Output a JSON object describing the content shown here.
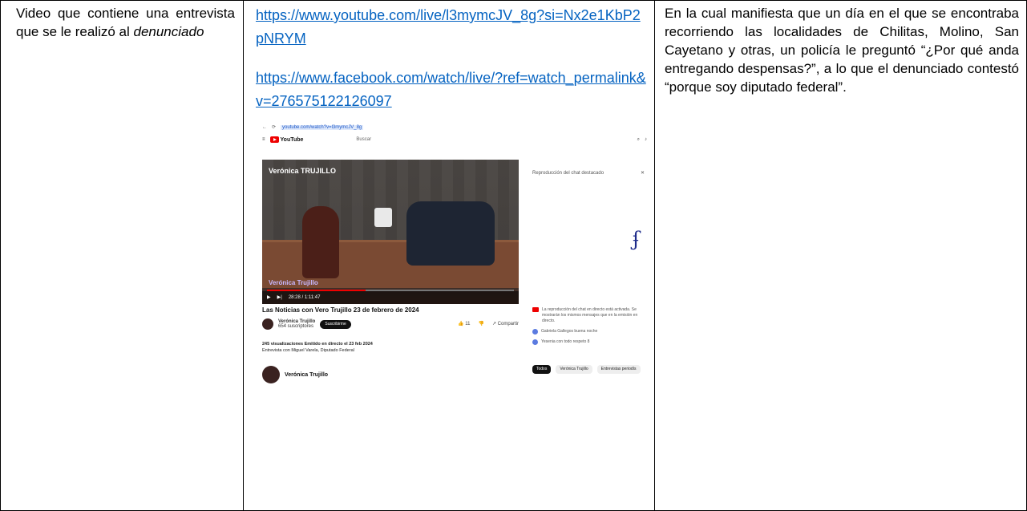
{
  "col1": {
    "text": "Video que contiene una entrevista que se le realizó al ",
    "italic": "denunciado"
  },
  "col2": {
    "link1": "https://www.youtube.com/live/l3mymcJV_8g?si=Nx2e1KbP2pNRYM",
    "link2": "https://www.facebook.com/watch/live/?ref=watch_permalink&v=276575122126097",
    "screenshot": {
      "url": "youtube.com/watch?v=l3mymcJV_8g",
      "brand": "YouTube",
      "search": "Buscar",
      "chat_header": "Reproducción del chat destacado",
      "video_overlay_title": "Verónica TRUJILLO",
      "video_overlay_name": "Verónica Trujillo",
      "time": "28:28 / 1:11:47",
      "video_title": "Las Noticias con Vero Trujillo 23 de febrero de 2024",
      "channel_name": "Verónica Trujillo",
      "subscribers": "654 suscriptores",
      "subscribe_label": "Suscribirme",
      "likes": "11",
      "share_label": "Compartir",
      "views_line": "245 visualizaciones  Emitido en directo el 23 feb 2024",
      "description": "Entrevista con Miguel Varela, Diputado Federal",
      "channel2_name": "Verónica Trujillo",
      "chat_notice": "La reproducción del chat en directo está activada. Se mostrarán los mismos mensajes que en la emisión en directo.",
      "chat_msg1": "Gabriela Gallegos  buena noche",
      "chat_msg2": "Yesenia  con todo respeto 8",
      "chip1": "Todos",
      "chip2": "Verónica Trujillo",
      "chip3": "Entrevistas periodís",
      "signature_icon": "handwritten-signature"
    }
  },
  "col3": {
    "text": "En la cual manifiesta que un día en el que se encontraba recorriendo las localidades de Chilitas, Molino, San Cayetano y otras, un policía le preguntó “¿Por qué anda entregando despensas?”, a lo que el denunciado contestó “porque soy diputado federal”."
  },
  "colors": {
    "link": "#0563c1",
    "border": "#000000"
  }
}
